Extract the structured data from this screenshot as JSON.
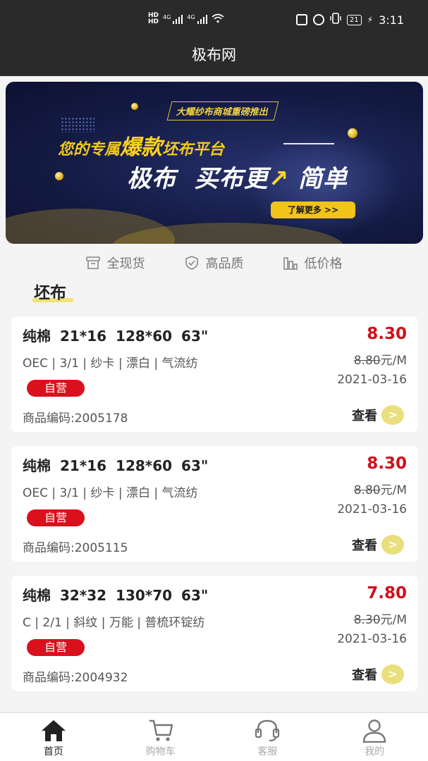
{
  "status_bar": {
    "left": {
      "hd1": "HD",
      "hd2": "HD",
      "net1": "4G",
      "net2": "4G"
    },
    "battery_level": "21",
    "time": "3:11"
  },
  "app_bar": {
    "title": "极布网"
  },
  "banner": {
    "tagline": "大耀纱布商城重磅推出",
    "line1_prefix": "您的专属",
    "line1_emphasis": "爆款",
    "line1_suffix": "坯布平台",
    "line2_part1": "极布",
    "line2_part2": "买布更",
    "line2_part3": "简单",
    "cta_label": "了解更多 >>",
    "accent_color": "#f0c419",
    "pager_active": 1,
    "pager_count": 1
  },
  "features": [
    {
      "icon": "box-icon",
      "label": "全现货"
    },
    {
      "icon": "shield-check-icon",
      "label": "高品质"
    },
    {
      "icon": "bar-chart-icon",
      "label": "低价格"
    }
  ],
  "section": {
    "title": "坯布"
  },
  "products": [
    {
      "title": "纯棉  21*16  128*60  63\"",
      "specs": "OEC | 3/1 | 纱卡 | 漂白 | 气流纺",
      "badge": "自营",
      "code": "商品编码:2005178",
      "price": "8.30",
      "old_price": "8.80",
      "unit": "元/M",
      "date": "2021-03-16",
      "view_label": "查看"
    },
    {
      "title": "纯棉  21*16  128*60  63\"",
      "specs": "OEC | 3/1 | 纱卡 | 漂白 | 气流纺",
      "badge": "自营",
      "code": "商品编码:2005115",
      "price": "8.30",
      "old_price": "8.80",
      "unit": "元/M",
      "date": "2021-03-16",
      "view_label": "查看"
    },
    {
      "title": "纯棉  32*32  130*70  63\"",
      "specs": "C | 2/1 | 斜纹 | 万能 | 普梳环锭纺",
      "badge": "自营",
      "code": "商品编码:2004932",
      "price": "7.80",
      "old_price": "8.30",
      "unit": "元/M",
      "date": "2021-03-16",
      "view_label": "查看"
    }
  ],
  "tab_bar": [
    {
      "icon": "home-icon",
      "label": "首页",
      "active": true
    },
    {
      "icon": "cart-icon",
      "label": "购物车",
      "active": false
    },
    {
      "icon": "headset-icon",
      "label": "客服",
      "active": false
    },
    {
      "icon": "user-icon",
      "label": "我的",
      "active": false
    }
  ],
  "colors": {
    "header_bg": "#2a2a2a",
    "price_red": "#d0101a",
    "badge_red": "#d8111c",
    "view_arrow": "#e9df7c",
    "section_underline": "#f1e27a"
  }
}
